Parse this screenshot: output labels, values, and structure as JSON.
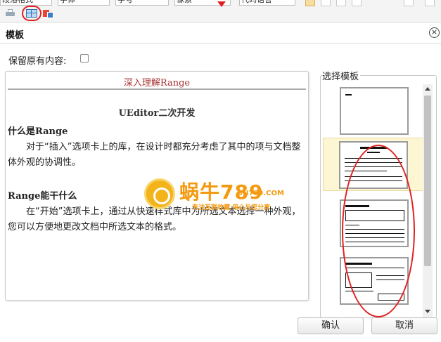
{
  "toolbar": {
    "fields": [
      "段落格式",
      "字体",
      "字号",
      "像素",
      "代码语言"
    ],
    "icons": [
      "print-icon",
      "template-icon",
      "wordimage-icon"
    ],
    "accent": "#e02020"
  },
  "dialog": {
    "title": "模板",
    "close_label": "×",
    "keep_label": "保留原有内容:",
    "keep_checked": false
  },
  "preview": {
    "title": "深入理解Range",
    "subheading": "UEditor二次开发",
    "section1": "什么是Range",
    "para1": "对于“插入”选项卡上的库，在设计时都充分考虑了其中的项与文档整体外观的协调性。",
    "section2": "Range能干什么",
    "para2": "在“开始”选项卡上，通过从快速样式库中为所选文本选择一种外观，您可以方便地更改文档中所选文本的格式。"
  },
  "watermark": {
    "name": "蜗牛789",
    "url": "UN789.COM",
    "slogan": "专注互联收藏  用心与您分享"
  },
  "chooser": {
    "legend": "选择模板",
    "selected_index": 1,
    "templates": [
      "blank-template",
      "title-lines-template",
      "box-lines-template",
      "two-box-template"
    ]
  },
  "buttons": {
    "ok": "确认",
    "cancel": "取消"
  }
}
